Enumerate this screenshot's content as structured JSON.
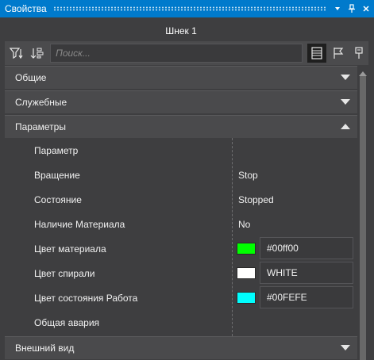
{
  "window": {
    "title": "Свойства"
  },
  "heading": "Шнек 1",
  "search": {
    "placeholder": "Поиск..."
  },
  "categories": {
    "general": "Общие",
    "service": "Служебные",
    "params": "Параметры",
    "appearance": "Внешний вид"
  },
  "properties": [
    {
      "name": "Параметр",
      "value": ""
    },
    {
      "name": "Вращение",
      "value": "Stop"
    },
    {
      "name": "Состояние",
      "value": "Stopped"
    },
    {
      "name": "Наличие Материала",
      "value": "No"
    },
    {
      "name": "Цвет материала",
      "value": "#00ff00",
      "swatch": "#00ff00"
    },
    {
      "name": "Цвет спирали",
      "value": "WHITE",
      "swatch": "#ffffff"
    },
    {
      "name": "Цвет состояния Работа",
      "value": "#00FEFE",
      "swatch": "#00fefe"
    },
    {
      "name": "Общая авария",
      "value": ""
    }
  ],
  "icons": {
    "titlebar": [
      "chevron-down-icon",
      "pin-icon",
      "close-icon"
    ],
    "toolbar_left": [
      "filter-icon",
      "sort-icon"
    ],
    "toolbar_right": [
      "list-view-icon",
      "flag-icon",
      "bookmark-icon"
    ]
  },
  "colors": {
    "accent": "#007acc",
    "panel": "#3e3e40",
    "category": "#4a4a4c"
  }
}
